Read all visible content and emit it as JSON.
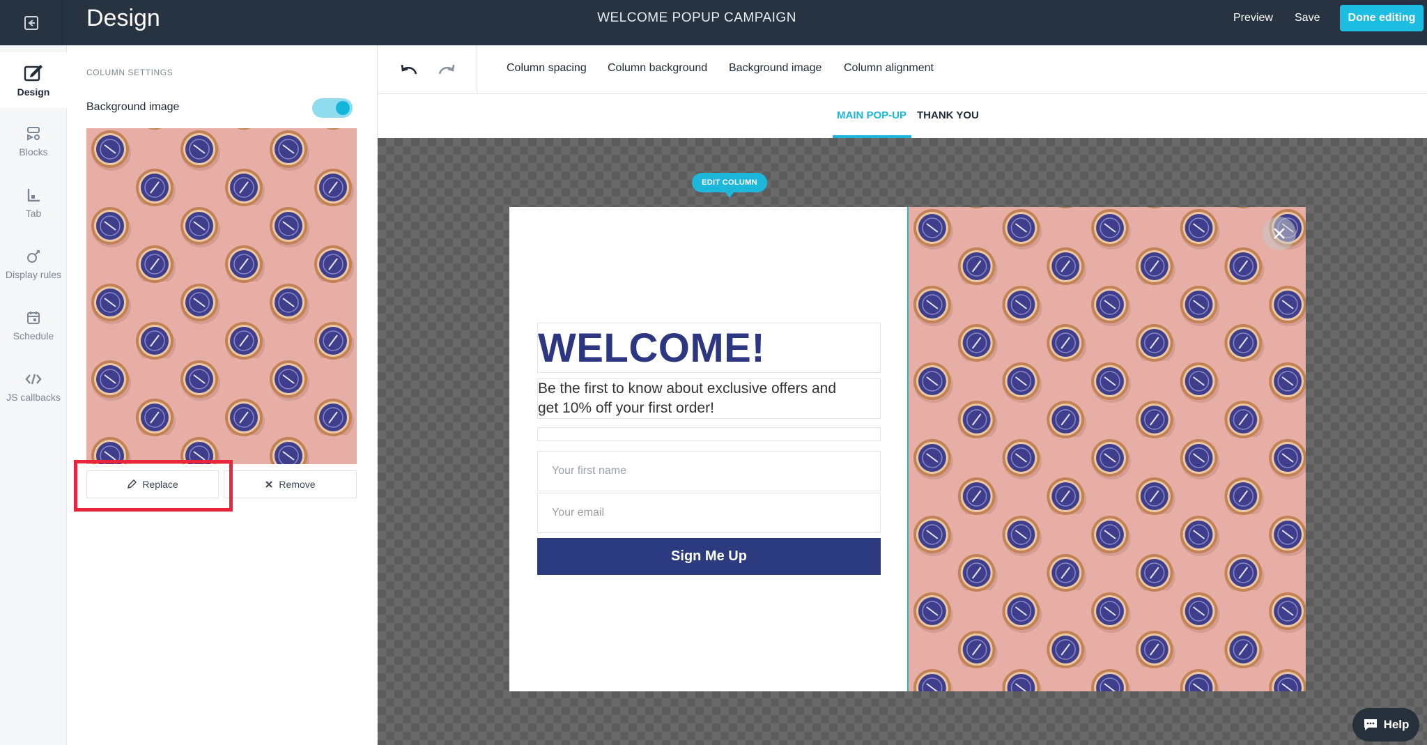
{
  "header": {
    "title": "Design",
    "campaign_name": "WELCOME POPUP CAMPAIGN",
    "preview_label": "Preview",
    "save_label": "Save",
    "done_label": "Done editing"
  },
  "rail": {
    "items": [
      {
        "label": "Design",
        "icon": "design-edit-icon",
        "active": true
      },
      {
        "label": "Blocks",
        "icon": "blocks-icon"
      },
      {
        "label": "Tab",
        "icon": "tab-icon"
      },
      {
        "label": "Display rules",
        "icon": "display-rules-icon"
      },
      {
        "label": "Schedule",
        "icon": "calendar-icon"
      },
      {
        "label": "JS callbacks",
        "icon": "code-icon"
      }
    ]
  },
  "panel": {
    "heading": "COLUMN SETTINGS",
    "background_image_label": "Background image",
    "background_image_enabled": true,
    "replace_label": "Replace",
    "remove_label": "Remove"
  },
  "toolbar": {
    "undo_icon": "undo-icon",
    "redo_icon": "redo-icon",
    "links": [
      "Column spacing",
      "Column background",
      "Background image",
      "Column alignment"
    ]
  },
  "tabs": {
    "main": "MAIN POP-UP",
    "thank_you": "THANK YOU",
    "active": "MAIN POP-UP"
  },
  "canvas": {
    "edit_column_label": "EDIT COLUMN"
  },
  "popup": {
    "headline": "WELCOME!",
    "subtext_line1": "Be the first to know about exclusive offers and",
    "subtext_line2": "get 10% off your first order!",
    "first_name_placeholder": "Your first name",
    "email_placeholder": "Your email",
    "signup_label": "Sign Me Up"
  },
  "help": {
    "label": "Help"
  },
  "colors": {
    "accent": "#1dbde2",
    "topbar": "#273340",
    "headline": "#2d3680",
    "button": "#2c3a80",
    "highlight": "#e8253b"
  }
}
